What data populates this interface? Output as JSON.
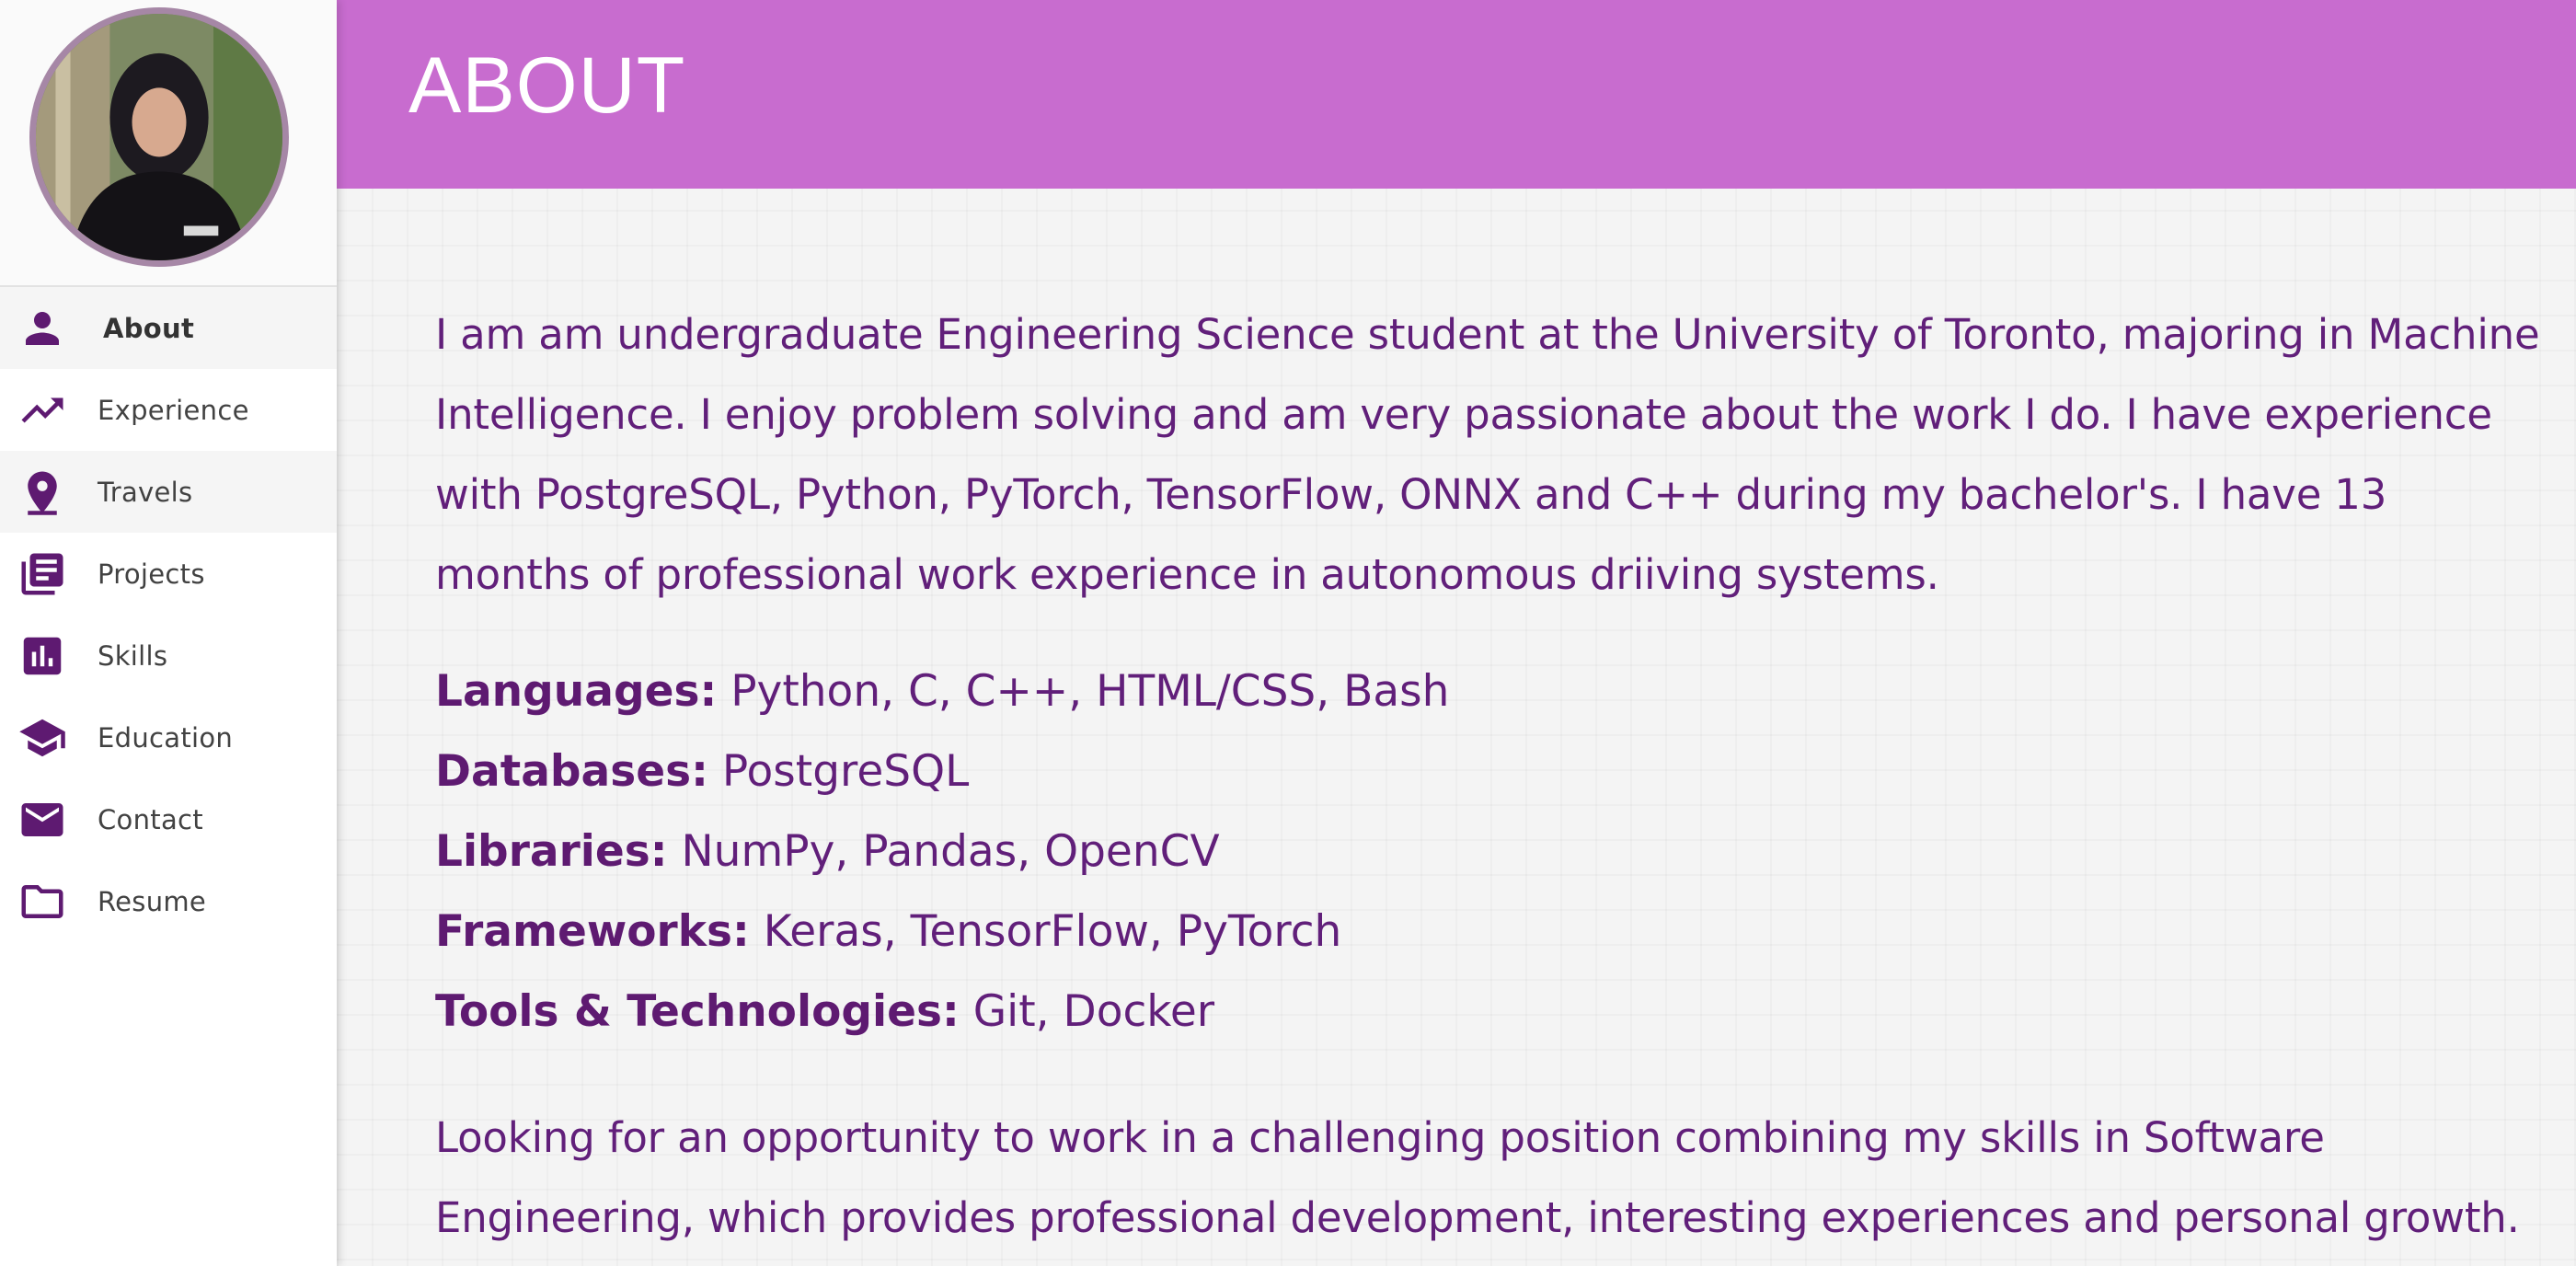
{
  "sidebar": {
    "nav": [
      {
        "label": "About",
        "icon": "person-icon",
        "active": true
      },
      {
        "label": "Experience",
        "icon": "trending-up-icon"
      },
      {
        "label": "Travels",
        "icon": "location-pin-icon"
      },
      {
        "label": "Projects",
        "icon": "library-books-icon"
      },
      {
        "label": "Skills",
        "icon": "bar-chart-icon"
      },
      {
        "label": "Education",
        "icon": "graduation-cap-icon"
      },
      {
        "label": "Contact",
        "icon": "mail-icon"
      },
      {
        "label": "Resume",
        "icon": "folder-icon"
      }
    ]
  },
  "header": {
    "title": "ABOUT"
  },
  "about": {
    "bio": "I am am undergraduate Engineering Science student at the University of Toronto, majoring in Machine Intelligence. I enjoy problem solving and am very passionate about the work I do. I have experience with PostgreSQL, Python, PyTorch, TensorFlow, ONNX and C++ during my bachelor's. I have 13 months of professional work experience in autonomous driiving systems.",
    "skills": [
      {
        "key": "Languages:",
        "value": "Python, C, C++, HTML/CSS, Bash"
      },
      {
        "key": "Databases:",
        "value": "PostgreSQL"
      },
      {
        "key": "Libraries:",
        "value": "NumPy, Pandas, OpenCV"
      },
      {
        "key": "Frameworks:",
        "value": "Keras, TensorFlow, PyTorch"
      },
      {
        "key": "Tools & Technologies:",
        "value": "Git, Docker"
      }
    ],
    "goal": "Looking for an opportunity to work in a challenging position combining my skills in Software Engineering, which provides professional development, interesting experiences and personal growth."
  },
  "colors": {
    "header_bg": "#c86ccf",
    "accent": "#5e1a71",
    "text": "#611f7a",
    "avatar_border": "#a687a6"
  }
}
